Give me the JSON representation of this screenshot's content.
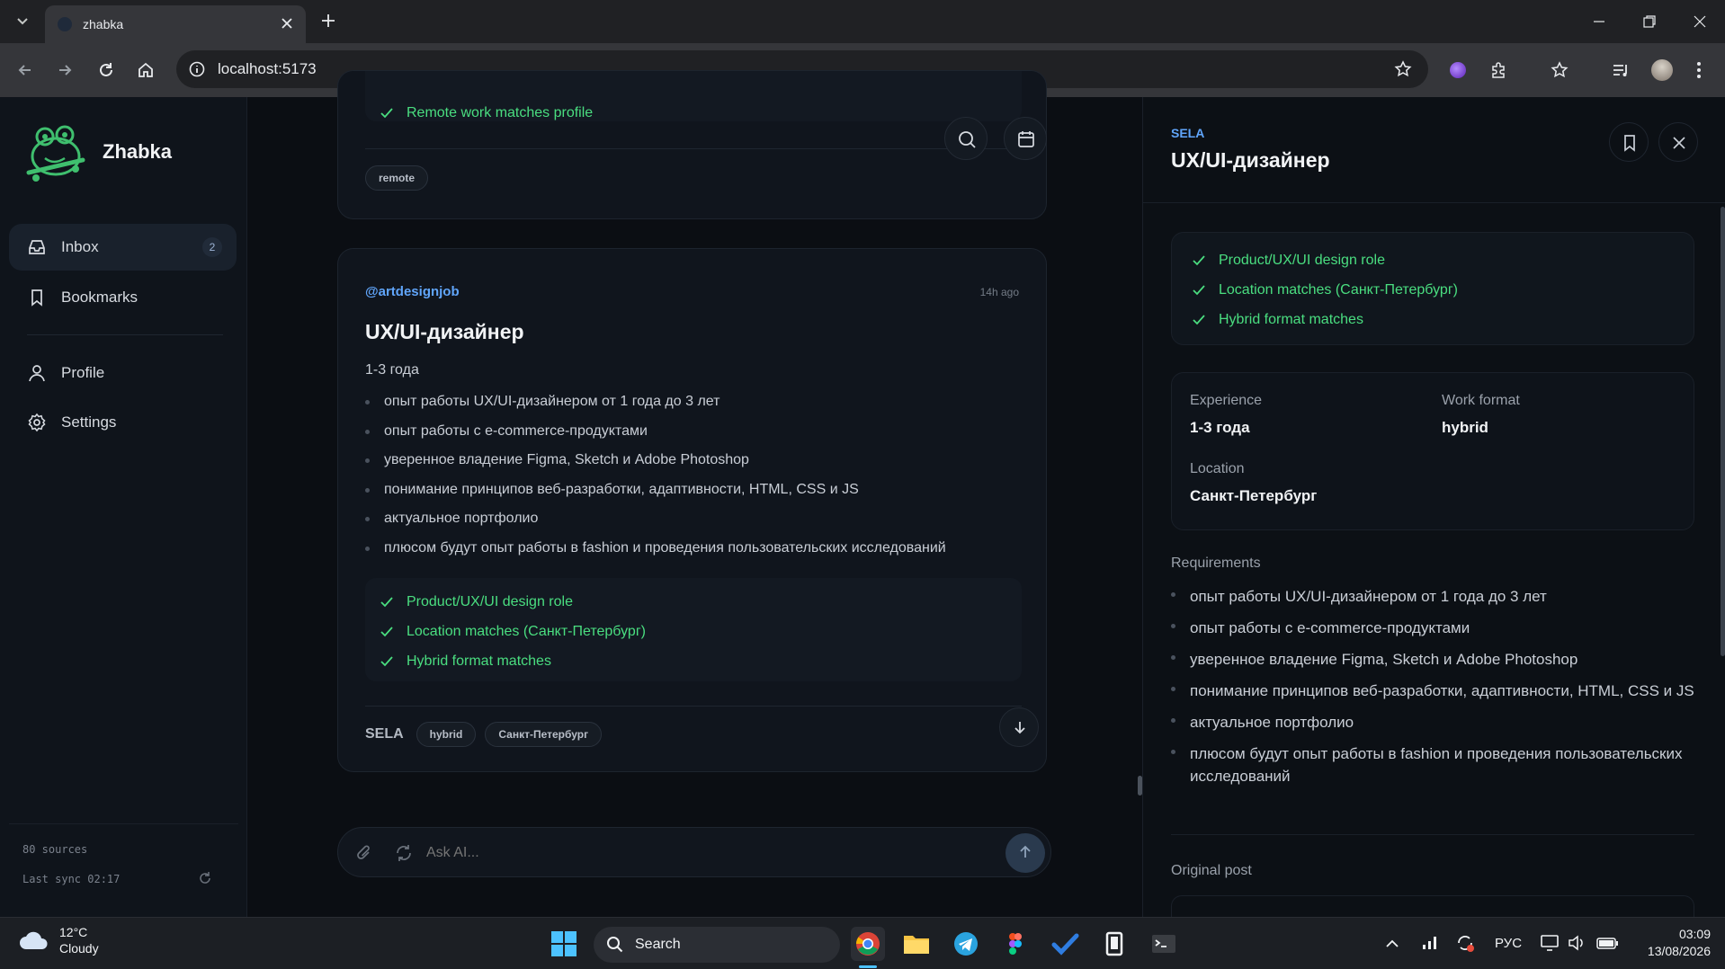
{
  "browser": {
    "tab_title": "zhabka",
    "url": "localhost:5173"
  },
  "sidebar": {
    "brand": "Zhabka",
    "nav": [
      {
        "label": "Inbox",
        "badge": "2",
        "icon": "inbox-icon",
        "active": true
      },
      {
        "label": "Bookmarks",
        "icon": "bookmark-icon"
      },
      {
        "label": "Profile",
        "icon": "user-icon"
      },
      {
        "label": "Settings",
        "icon": "gear-icon"
      }
    ],
    "footer": {
      "sources": "80 sources",
      "last_sync": "Last sync 02:17"
    }
  },
  "feed": {
    "prev_card": {
      "match": "Remote work matches profile",
      "tag": "remote"
    },
    "card": {
      "author": "@artdesignjob",
      "time": "14h ago",
      "title": "UX/UI-дизайнер",
      "experience": "1-3 года",
      "requirements": [
        "опыт работы UX/UI-дизайнером от 1 года до 3 лет",
        "опыт работы с e-commerce-продуктами",
        "уверенное владение Figma, Sketch и Adobe Photoshop",
        "понимание принципов веб-разработки, адаптивности, HTML, CSS и JS",
        "актуальное портфолио",
        "плюсом будут опыт работы в fashion и проведения пользовательских исследований"
      ],
      "matches": [
        "Product/UX/UI design role",
        "Location matches (Санкт-Петербург)",
        "Hybrid format matches"
      ],
      "company": "SELA",
      "tags": [
        "hybrid",
        "Санкт-Петербург"
      ]
    },
    "ask_placeholder": "Ask AI..."
  },
  "detail": {
    "company": "SELA",
    "title": "UX/UI-дизайнер",
    "matches": [
      "Product/UX/UI design role",
      "Location matches (Санкт-Петербург)",
      "Hybrid format matches"
    ],
    "info": {
      "experience_label": "Experience",
      "experience_value": "1-3 года",
      "format_label": "Work format",
      "format_value": "hybrid",
      "location_label": "Location",
      "location_value": "Санкт-Петербург"
    },
    "requirements_label": "Requirements",
    "requirements": [
      "опыт работы UX/UI-дизайнером от 1 года до 3 лет",
      "опыт работы с e-commerce-продуктами",
      "уверенное владение Figma, Sketch и Adobe Photoshop",
      "понимание принципов веб-разработки, адаптивности, HTML, CSS и JS",
      "актуальное портфолио",
      "плюсом будут опыт работы в fashion и проведения пользовательских исследований"
    ],
    "original_post_label": "Original post"
  },
  "taskbar": {
    "weather_temp": "12°C",
    "weather_desc": "Cloudy",
    "search": "Search",
    "lang": "РУС",
    "time": "03:09",
    "date": "13/08/2026"
  },
  "colors": {
    "accent_green": "#4ade80",
    "accent_blue": "#60a5fa",
    "background": "#0b0e13"
  }
}
